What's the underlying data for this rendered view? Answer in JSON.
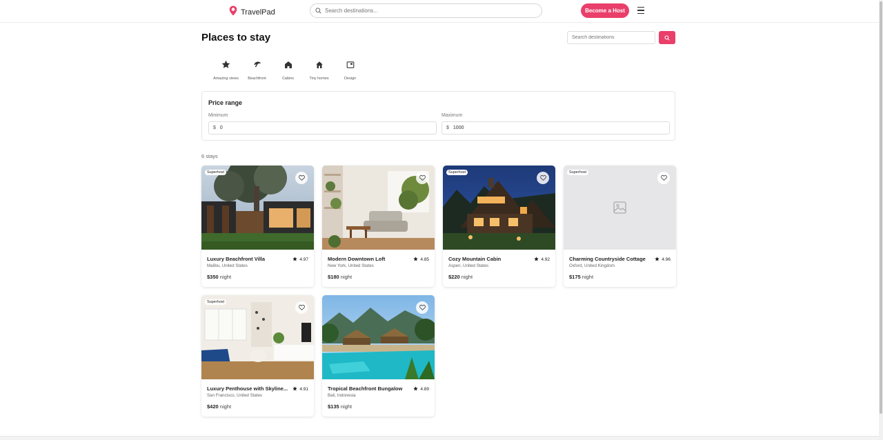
{
  "header": {
    "brand": "TravelPad",
    "search_placeholder": "Search destinations...",
    "host_button": "Become a Host",
    "brand_color": "#e93f6a"
  },
  "page": {
    "title": "Places to stay",
    "side_search_placeholder": "Search destinations"
  },
  "categories": [
    {
      "label": "Amazing views",
      "icon": "star-icon"
    },
    {
      "label": "Beachfront",
      "icon": "beach-icon"
    },
    {
      "label": "Cabins",
      "icon": "cabin-icon"
    },
    {
      "label": "Tiny homes",
      "icon": "tiny-home-icon"
    },
    {
      "label": "Design",
      "icon": "design-icon"
    }
  ],
  "price_range": {
    "title": "Price range",
    "min_label": "Minimum",
    "max_label": "Maximum",
    "currency": "$",
    "min_value": "0",
    "max_value": "1000"
  },
  "results": {
    "count_text": "6 stays",
    "price_unit": "night",
    "listings": [
      {
        "title": "Luxury Beachfront Villa",
        "location": "Malibu, United States",
        "rating": "4.97",
        "price": "$350",
        "badge": "Superhost",
        "image": "modern-house-photo"
      },
      {
        "title": "Modern Downtown Loft",
        "location": "New York, United States",
        "rating": "4.85",
        "price": "$180",
        "badge": "",
        "image": "loft-interior-photo"
      },
      {
        "title": "Cozy Mountain Cabin",
        "location": "Aspen, United States",
        "rating": "4.92",
        "price": "$220",
        "badge": "Superhost",
        "image": "cabin-night-photo"
      },
      {
        "title": "Charming Countryside Cottage",
        "location": "Oxford, United Kingdom",
        "rating": "4.96",
        "price": "$175",
        "badge": "Superhost",
        "image": "image-placeholder"
      },
      {
        "title": "Luxury Penthouse with Skyline...",
        "location": "San Francisco, United States",
        "rating": "4.91",
        "price": "$420",
        "badge": "Superhost",
        "image": "penthouse-interior-photo"
      },
      {
        "title": "Tropical Beachfront Bungalow",
        "location": "Bali, Indonesia",
        "rating": "4.89",
        "price": "$135",
        "badge": "",
        "image": "tropical-pool-photo"
      }
    ]
  }
}
